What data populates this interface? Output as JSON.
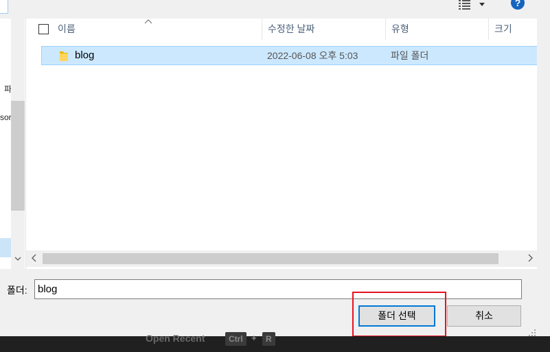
{
  "toolbar": {
    "view_icon": "view-list-icon",
    "dropdown_icon": "chevron-down-icon",
    "help_label": "?"
  },
  "nav_pane": {
    "fragments": [
      "파",
      "sor"
    ]
  },
  "file_list": {
    "columns": [
      "이름",
      "수정한 날짜",
      "유형",
      "크기"
    ],
    "sort_indicator": "^",
    "rows": [
      {
        "name": "blog",
        "modified": "2022-06-08 오후 5:03",
        "type": "파일 폴더",
        "size": "",
        "icon": "folder-icon"
      }
    ]
  },
  "scroll": {
    "left": "<",
    "right": ">",
    "up": "^",
    "down": "v"
  },
  "bottom": {
    "folder_label": "폴더:",
    "folder_value": "blog",
    "select_button": "폴더 선택",
    "cancel_button": "취소"
  },
  "app_behind": {
    "menu_item": "Open Recent",
    "shortcut_keys": [
      "Ctrl",
      "+",
      "R"
    ]
  },
  "colors": {
    "selection": "#cce8ff",
    "accent": "#0078d7",
    "highlight": "#e81123"
  }
}
